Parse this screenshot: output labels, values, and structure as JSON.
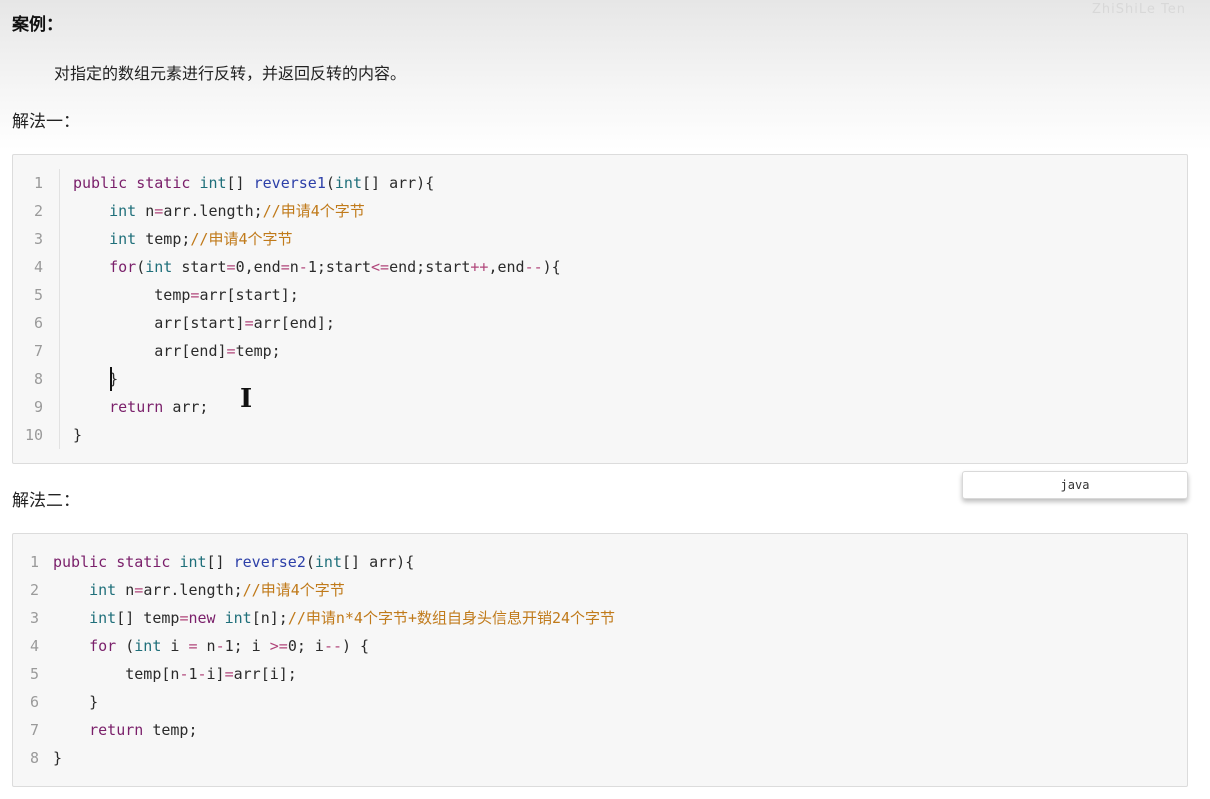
{
  "case_title": "案例：",
  "description": "对指定的数组元素进行反转，并返回反转的内容。",
  "method1_title": "解法一：",
  "method2_title": "解法二：",
  "code_language": "java",
  "watermark": "ZhiShiLe Ten",
  "code1": {
    "line_numbers": [
      "1",
      "2",
      "3",
      "4",
      "5",
      "6",
      "7",
      "8",
      "9",
      "10"
    ],
    "t": {
      "l1_kw1": "public",
      "l1_kw2": "static",
      "l1_ty": "int",
      "l1_br": "[] ",
      "l1_fn": "reverse1",
      "l1_p": "(",
      "l1_ty2": "int",
      "l1_br2": "[] arr){",
      "l2_ty": "int",
      "l2_code": " n",
      "l2_op": "=",
      "l2_rest": "arr.length;",
      "l2_cm": "//申请4个字节",
      "l3_ty": "int",
      "l3_code": " temp;",
      "l3_cm": "//申请4个字节",
      "l4_kw": "for",
      "l4_p": "(",
      "l4_ty": "int",
      "l4_a": " start",
      "l4_op1": "=",
      "l4_n0": "0",
      "l4_b": ",end",
      "l4_op2": "=",
      "l4_c": "n",
      "l4_op3": "-",
      "l4_n1": "1",
      "l4_d": ";start",
      "l4_op4": "<=",
      "l4_e": "end;start",
      "l4_op5": "++",
      "l4_f": ",end",
      "l4_op6": "--",
      "l4_g": "){",
      "l5_a": "temp",
      "l5_op": "=",
      "l5_b": "arr[start];",
      "l6_a": "arr[start]",
      "l6_op": "=",
      "l6_b": "arr[end];",
      "l7_a": "arr[end]",
      "l7_op": "=",
      "l7_b": "temp;",
      "l8": "}",
      "l9_kw": "return",
      "l9_b": " arr;",
      "l10": "}"
    }
  },
  "code2": {
    "line_numbers": [
      "1",
      "2",
      "3",
      "4",
      "5",
      "6",
      "7",
      "8"
    ],
    "t": {
      "l1_kw1": "public",
      "l1_kw2": "static",
      "l1_ty": "int",
      "l1_br": "[] ",
      "l1_fn": "reverse2",
      "l1_p": "(",
      "l1_ty2": "int",
      "l1_br2": "[] arr){",
      "l2_ty": "int",
      "l2_code": " n",
      "l2_op": "=",
      "l2_rest": "arr.length;",
      "l2_cm": "//申请4个字节",
      "l3_ty": "int",
      "l3_a": "[] temp",
      "l3_op": "=",
      "l3_kw": "new",
      "l3_ty2": "int",
      "l3_b": "[n];",
      "l3_cm": "//申请n*4个字节+数组自身头信息开销24个字节",
      "l4_kw": "for",
      "l4_a": " (",
      "l4_ty": "int",
      "l4_b": " i ",
      "l4_op1": "=",
      "l4_c": " n",
      "l4_op2": "-",
      "l4_n1": "1",
      "l4_d": "; i ",
      "l4_op3": ">=",
      "l4_n0": "0",
      "l4_e": "; i",
      "l4_op4": "--",
      "l4_f": ") {",
      "l5_a": "temp[n",
      "l5_op1": "-",
      "l5_n1": "1",
      "l5_op2": "-",
      "l5_b": "i]",
      "l5_op3": "=",
      "l5_c": "arr[i];",
      "l6": "}",
      "l7_kw": "return",
      "l7_b": " temp;",
      "l8": "}"
    }
  }
}
